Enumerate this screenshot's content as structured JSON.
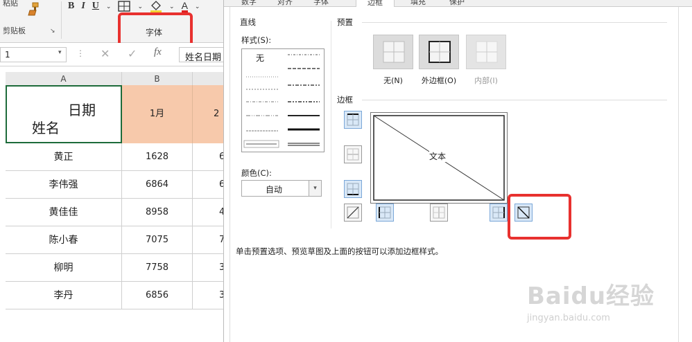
{
  "ribbon": {
    "paste_label": "粘贴",
    "clipboard_label": "剪贴板",
    "launcher_glyph": "↘",
    "bold": "B",
    "italic": "I",
    "underline": "U",
    "font_color_letter": "A",
    "font_group_label": "字体"
  },
  "formula_bar": {
    "name_box": "1",
    "dots": "⋮",
    "cancel": "✕",
    "enter": "✓",
    "fx": "fx",
    "content": "姓名日期"
  },
  "sheet": {
    "columns": [
      "A",
      "B"
    ],
    "header": {
      "date": "日期",
      "name": "姓名",
      "month": "1月",
      "next_month_partial": "2"
    },
    "rows": [
      {
        "name": "黄正",
        "jan": "1628",
        "next": "6"
      },
      {
        "name": "李伟强",
        "jan": "6864",
        "next": "6"
      },
      {
        "name": "黄佳佳",
        "jan": "8958",
        "next": "4"
      },
      {
        "name": "陈小春",
        "jan": "7075",
        "next": "7"
      },
      {
        "name": "柳明",
        "jan": "7758",
        "next": "3"
      },
      {
        "name": "李丹",
        "jan": "6856",
        "next": "3"
      }
    ]
  },
  "dialog": {
    "tabs": [
      "数字",
      "对齐",
      "字体",
      "边框",
      "填充",
      "保护"
    ],
    "active_tab": "边框",
    "line_section": "直线",
    "style_label": "样式(S):",
    "none_style": "无",
    "color_label": "颜色(C):",
    "color_value": "自动",
    "presets_section": "预置",
    "presets": [
      {
        "label": "无(N)",
        "disabled": false
      },
      {
        "label": "外边框(O)",
        "disabled": false
      },
      {
        "label": "内部(I)",
        "disabled": true
      }
    ],
    "border_section": "边框",
    "preview_text": "文本",
    "hint": "单击预置选项、预览草图及上面的按钮可以添加边框样式。"
  },
  "watermark": {
    "logo": "Baidu经验",
    "url": "jingyan.baidu.com"
  },
  "colors": {
    "highlight": "#e8312f",
    "header_fill": "#f7c9ab",
    "selection_border": "#1d6b3a"
  }
}
